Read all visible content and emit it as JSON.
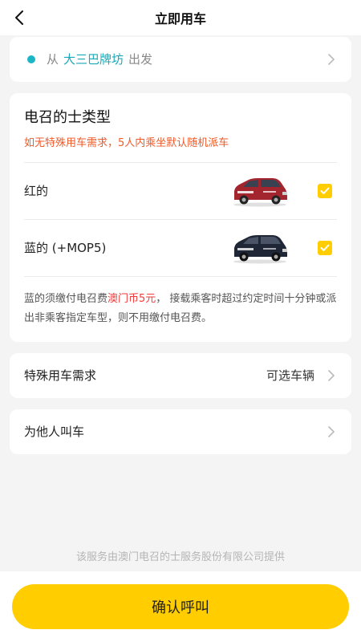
{
  "header": {
    "title": "立即用车"
  },
  "origin": {
    "prefix": "从",
    "place": "大三巴牌坊",
    "suffix": "出发"
  },
  "taxi_type": {
    "title": "电召的士类型",
    "notice": "如无特殊用车需求，5人内乘坐默认随机派车",
    "options": [
      {
        "label": "红的",
        "checked": true,
        "car_color": "#a3262e"
      },
      {
        "label": "蓝的 (+MOP5)",
        "checked": true,
        "car_color": "#1f2636"
      }
    ],
    "fee_note_prefix": "蓝的须缴付电召费",
    "fee_amount": "澳门币5元",
    "fee_note_suffix": "， 接载乘客时超过约定时间十分钟或派出非乘客指定车型，则不用缴付电召费。"
  },
  "special_request": {
    "label": "特殊用车需求",
    "value": "可选车辆"
  },
  "call_for_others": {
    "label": "为他人叫车"
  },
  "footer": {
    "provider_text": "该服务由澳门电召的士服务股份有限公司提供",
    "confirm_label": "确认呼叫"
  },
  "colors": {
    "accent": "#ffcd00",
    "place": "#1aa9b9",
    "notice": "#ef5a2a",
    "fee": "#ef3b3b"
  }
}
